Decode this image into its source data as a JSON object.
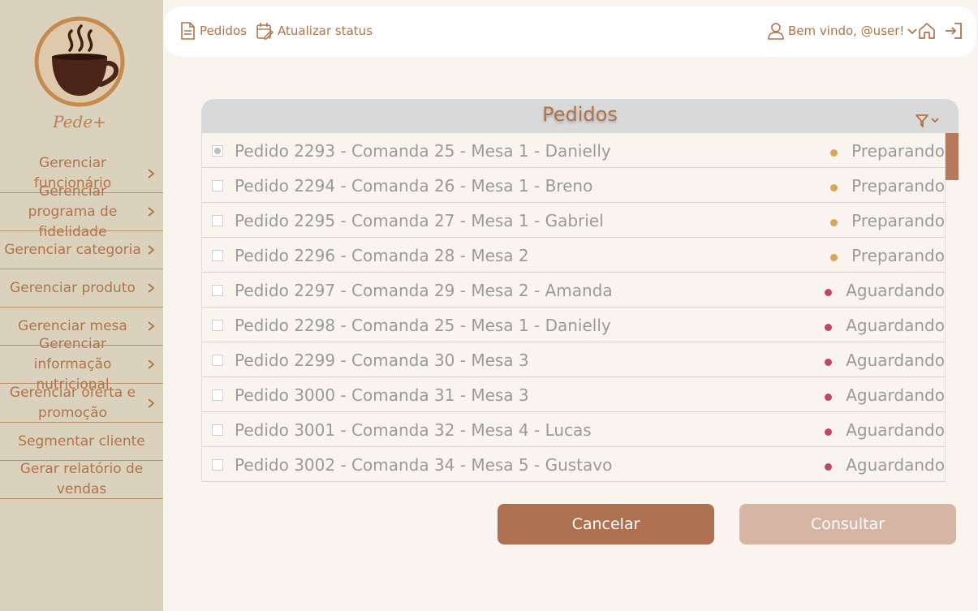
{
  "sidebar": {
    "logo_text": "Pede+",
    "items": [
      {
        "label": "Gerenciar funcionário",
        "chevron": true
      },
      {
        "label": "Gerenciar programa de fidelidade",
        "chevron": true
      },
      {
        "label": "Gerenciar categoria",
        "chevron": true
      },
      {
        "label": "Gerenciar produto",
        "chevron": true
      },
      {
        "label": "Gerenciar mesa",
        "chevron": true
      },
      {
        "label": "Gerenciar informação nutricional",
        "chevron": true
      },
      {
        "label": "Gerenciar oferta e promoção",
        "chevron": true
      },
      {
        "label": "Segmentar cliente",
        "chevron": false
      },
      {
        "label": "Gerar relatório de vendas",
        "chevron": false
      }
    ]
  },
  "topbar": {
    "orders_link": "Pedidos",
    "update_status_link": "Atualizar status",
    "welcome": "Bem vindo, @user!",
    "icons": [
      "document-icon",
      "calendar-edit-icon",
      "user-icon",
      "chevron-down-icon",
      "home-icon",
      "logout-icon"
    ]
  },
  "panel": {
    "title": "Pedidos",
    "filter_icon": "filter-icon",
    "orders": [
      {
        "label": "Pedido 2293 - Comanda 25 - Mesa 1 - Danielly",
        "status": "Preparando",
        "checked": true
      },
      {
        "label": "Pedido 2294 - Comanda 26 - Mesa 1 - Breno",
        "status": "Preparando",
        "checked": false
      },
      {
        "label": "Pedido 2295 - Comanda 27 - Mesa 1 - Gabriel",
        "status": "Preparando",
        "checked": false
      },
      {
        "label": "Pedido 2296 - Comanda 28 - Mesa 2",
        "status": "Preparando",
        "checked": false
      },
      {
        "label": "Pedido 2297 - Comanda 29 - Mesa 2 - Amanda",
        "status": "Aguardando",
        "checked": false
      },
      {
        "label": "Pedido 2298 - Comanda 25 - Mesa 1 - Danielly",
        "status": "Aguardando",
        "checked": false
      },
      {
        "label": "Pedido 2299 - Comanda 30 - Mesa 3",
        "status": "Aguardando",
        "checked": false
      },
      {
        "label": "Pedido 3000 - Comanda 31 - Mesa 3",
        "status": "Aguardando",
        "checked": false
      },
      {
        "label": "Pedido 3001 - Comanda 32 - Mesa 4 - Lucas",
        "status": "Aguardando",
        "checked": false
      },
      {
        "label": "Pedido 3002 - Comanda 34 - Mesa 5 - Gustavo",
        "status": "Aguardando",
        "checked": false
      }
    ]
  },
  "status_colors": {
    "Preparando": "#d9a55a",
    "Aguardando": "#c2456a"
  },
  "buttons": {
    "cancel": "Cancelar",
    "consult": "Consultar"
  },
  "colors": {
    "accent": "#b0734b",
    "sidebar_bg": "#dad2bd",
    "page_bg": "#f9f5ee",
    "cancel_bg": "#b07152",
    "consult_bg": "#d7b5a5"
  }
}
